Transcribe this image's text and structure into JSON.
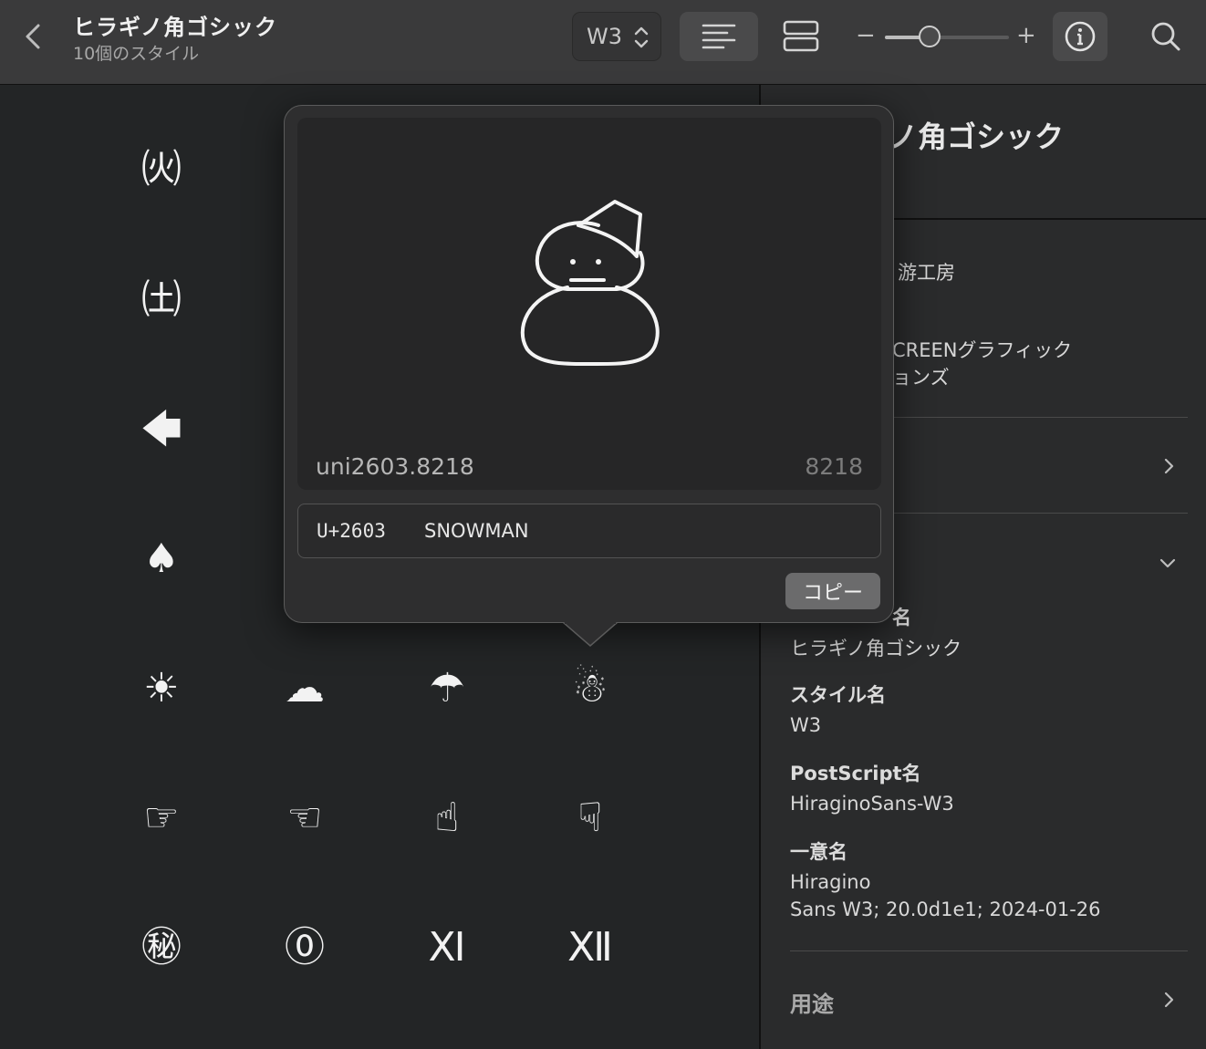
{
  "toolbar": {
    "title": "ヒラギノ角ゴシック",
    "subtitle": "10個のスタイル",
    "style_value": "W3",
    "zoom_minus": "−",
    "zoom_plus": "+",
    "zoom_level": 0.36,
    "icons": [
      "chevron-left-icon",
      "up-down-chevron-icon",
      "text-align-left-icon",
      "two-row-layout-icon",
      "info-icon",
      "search-icon"
    ]
  },
  "glyph_grid": {
    "rows": [
      [
        "㈫"
      ],
      [
        "㈯"
      ],
      [
        "🡄"
      ],
      [
        "♠"
      ],
      [
        "☀",
        "☁",
        "☂",
        "☃"
      ],
      [
        "☞",
        "☜",
        "☝",
        "☟"
      ],
      [
        "㊙",
        "⓪",
        "Ⅺ",
        "Ⅻ"
      ]
    ]
  },
  "popover": {
    "glyph_name": "uni2603.8218",
    "glyph_id": "8218",
    "code_point": "U+2603",
    "char_name": "SNOWMAN",
    "copy_label": "コピー"
  },
  "info_panel": {
    "heading_visible": "ノ角ゴシック",
    "design_line": "游工房",
    "maker_line1": "CREENグラフィック",
    "maker_line2": "ョンズ",
    "family_label_partial": "名",
    "family_value": "ヒラギノ角ゴシック",
    "style_label": "スタイル名",
    "style_value": "W3",
    "postscript_label": "PostScript名",
    "postscript_value": "HiraginoSans-W3",
    "unique_label": "一意名",
    "unique_value_line1": "Hiragino",
    "unique_value_line2": "Sans W3; 20.0d1e1; 2024-01-26",
    "usage_label": "用途"
  },
  "colors": {
    "background": "#232526",
    "toolbar": "#3a3a3b",
    "popover": "#2e2e2f",
    "copy_button": "#6b6b6c"
  }
}
